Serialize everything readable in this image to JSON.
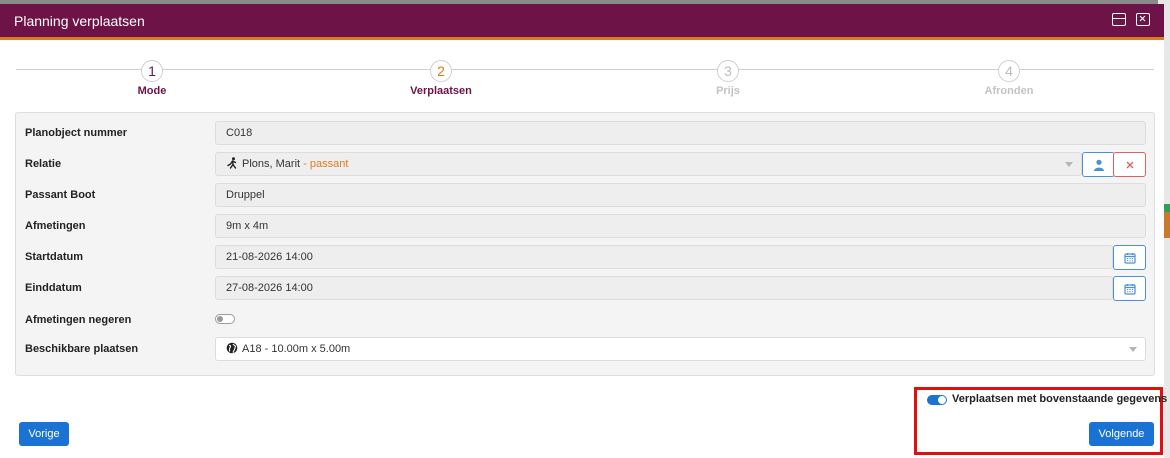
{
  "dialog": {
    "title": "Planning verplaatsen"
  },
  "stepper": {
    "steps": [
      {
        "number": "1",
        "label": "Mode",
        "state": "done"
      },
      {
        "number": "2",
        "label": "Verplaatsen",
        "state": "active"
      },
      {
        "number": "3",
        "label": "Prijs",
        "state": "pending"
      },
      {
        "number": "4",
        "label": "Afronden",
        "state": "pending"
      }
    ]
  },
  "form": {
    "planobject": {
      "label": "Planobject nummer",
      "value": "C018"
    },
    "relatie": {
      "label": "Relatie",
      "name": "Plons, Marit",
      "suffix": "- passant",
      "icon": "walking-person-icon"
    },
    "passant_boot": {
      "label": "Passant Boot",
      "value": "Druppel"
    },
    "afmetingen": {
      "label": "Afmetingen",
      "value": "9m x 4m"
    },
    "startdatum": {
      "label": "Startdatum",
      "value": "21-08-2026 14:00"
    },
    "einddatum": {
      "label": "Einddatum",
      "value": "27-08-2026 14:00"
    },
    "afmetingen_negeren": {
      "label": "Afmetingen negeren",
      "checked": false
    },
    "plaatsen": {
      "label": "Beschikbare plaatsen",
      "value": "A18 - 10.00m x 5.00m",
      "icon": "globe-icon"
    }
  },
  "footer": {
    "prev_label": "Vorige",
    "next_label": "Volgende",
    "toggle_label": "Verplaatsen met bovenstaande gegevens",
    "toggle_checked": true
  },
  "colors": {
    "titlebar": "#6e1347",
    "accent": "#e07a1f",
    "primary": "#1a73d2",
    "highlight": "#e01010"
  }
}
